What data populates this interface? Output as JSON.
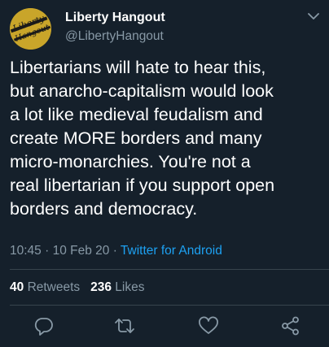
{
  "author": {
    "display_name": "Liberty Hangout",
    "handle": "@LibertyHangout",
    "avatar_text_line1": "Liberty",
    "avatar_text_line2": "Hangout"
  },
  "tweet": {
    "lines": [
      "Libertarians will hate to hear this,",
      "but anarcho-capitalism would look",
      "a lot like medieval feudalism and",
      "create MORE borders and many",
      "micro-monarchies. You're not a",
      "real libertarian if you support open",
      "borders and democracy."
    ],
    "time": "10:45",
    "separator1": "·",
    "date": "10 Feb 20",
    "separator2": "·",
    "source": "Twitter for Android"
  },
  "stats": {
    "retweets_count": "40",
    "retweets_label": "Retweets",
    "likes_count": "236",
    "likes_label": "Likes"
  },
  "icons": {
    "menu": "chevron-down-icon",
    "reply": "reply-icon",
    "retweet": "retweet-icon",
    "like": "heart-icon",
    "share": "share-icon"
  },
  "colors": {
    "background": "#15202b",
    "text": "#ffffff",
    "secondary": "#8899a6",
    "link": "#1da1f2",
    "divider": "#38444d",
    "avatar": "#c9a52a"
  }
}
